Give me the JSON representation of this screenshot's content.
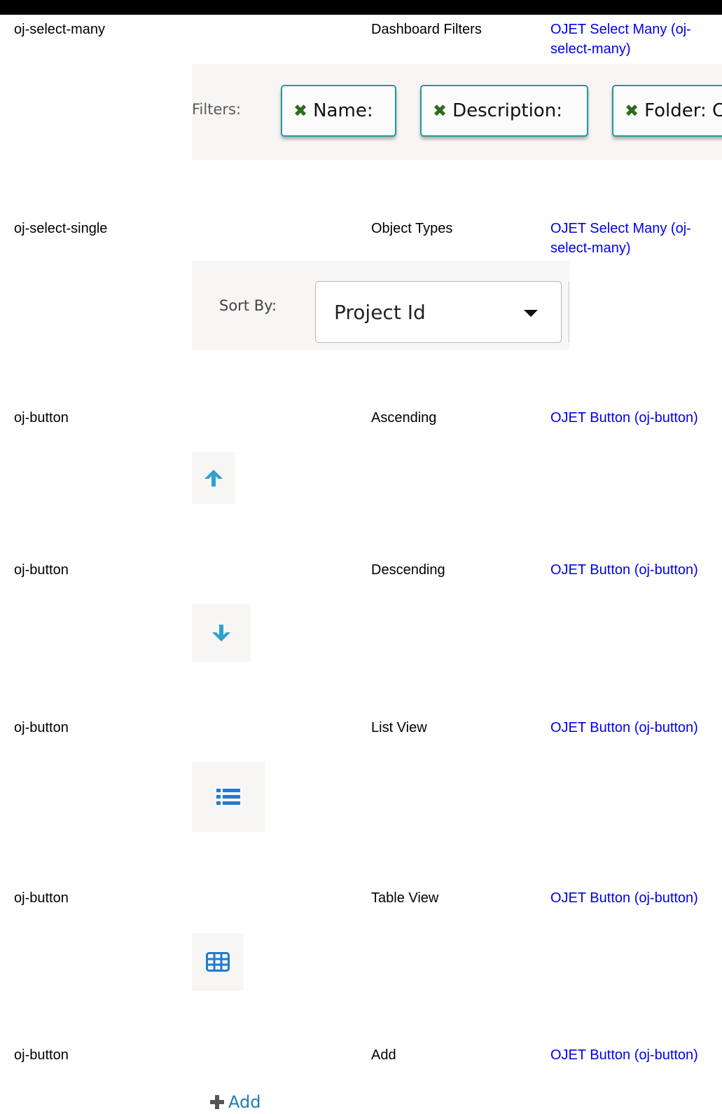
{
  "rows": [
    {
      "component": "oj-select-many",
      "name": "Dashboard Filters",
      "link": "OJET Select Many (oj-select-many)"
    },
    {
      "component": "oj-select-single",
      "name": "Object Types",
      "link": "OJET Select Many (oj-select-many)"
    },
    {
      "component": "oj-button",
      "name": "Ascending",
      "link": "OJET Button (oj-button)"
    },
    {
      "component": "oj-button",
      "name": "Descending",
      "link": "OJET Button (oj-button)"
    },
    {
      "component": "oj-button",
      "name": "List View",
      "link": "OJET Button (oj-button)"
    },
    {
      "component": "oj-button",
      "name": "Table View",
      "link": "OJET Button (oj-button)"
    },
    {
      "component": "oj-button",
      "name": "Add",
      "link": "OJET Button (oj-button)"
    }
  ],
  "filters": {
    "label": "Filters:",
    "chips": [
      "Name:",
      "Description:",
      "Folder: C"
    ]
  },
  "sort": {
    "label": "Sort By:",
    "value": "Project Id"
  },
  "add": {
    "label": "Add"
  },
  "colors": {
    "link": "#0000ee",
    "icon_blue": "#2f9fd0",
    "chip_border": "#1f9a9a",
    "chip_x": "#2e6b1c",
    "preview_bg": "#f8f6f5"
  },
  "icons": [
    "close-icon",
    "caret-down-icon",
    "arrow-up-icon",
    "arrow-down-icon",
    "list-icon",
    "table-grid-icon",
    "plus-icon"
  ]
}
